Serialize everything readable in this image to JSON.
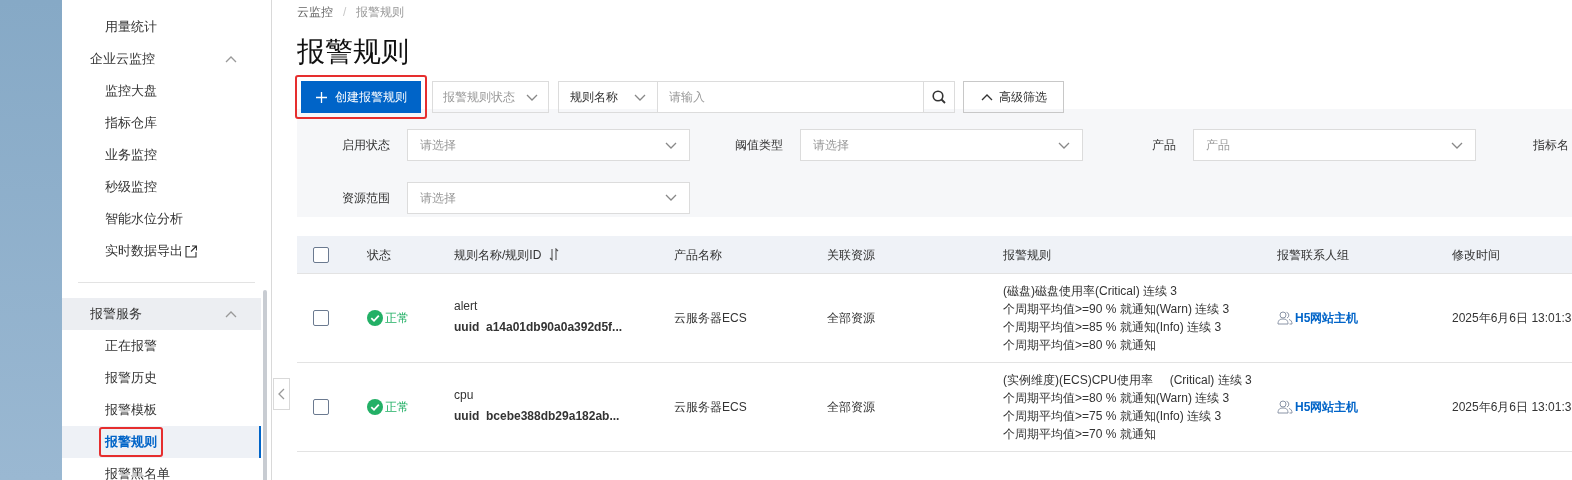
{
  "sidebar": {
    "top_items": [
      {
        "label": "用量统计"
      }
    ],
    "groups": [
      {
        "label": "企业云监控",
        "expanded": true,
        "shaded": false,
        "items": [
          {
            "label": "监控大盘",
            "selected": false,
            "external": false,
            "highlighted": false
          },
          {
            "label": "指标仓库",
            "selected": false,
            "external": false,
            "highlighted": false
          },
          {
            "label": "业务监控",
            "selected": false,
            "external": false,
            "highlighted": false
          },
          {
            "label": "秒级监控",
            "selected": false,
            "external": false,
            "highlighted": false
          },
          {
            "label": "智能水位分析",
            "selected": false,
            "external": false,
            "highlighted": false
          },
          {
            "label": "实时数据导出",
            "selected": false,
            "external": true,
            "highlighted": false
          }
        ]
      },
      {
        "label": "报警服务",
        "expanded": true,
        "shaded": true,
        "items": [
          {
            "label": "正在报警",
            "selected": false,
            "external": false,
            "highlighted": false
          },
          {
            "label": "报警历史",
            "selected": false,
            "external": false,
            "highlighted": false
          },
          {
            "label": "报警模板",
            "selected": false,
            "external": false,
            "highlighted": false
          },
          {
            "label": "报警规则",
            "selected": true,
            "external": false,
            "highlighted": true
          },
          {
            "label": "报警黑名单",
            "selected": false,
            "external": false,
            "highlighted": false
          }
        ]
      }
    ]
  },
  "breadcrumb": {
    "separator": "/",
    "items": [
      "云监控",
      "报警规则"
    ]
  },
  "title": "报警规则",
  "toolbar": {
    "create_button": {
      "label": "创建报警规则",
      "highlighted": true
    },
    "status_select": {
      "placeholder": "报警规则状态"
    },
    "search": {
      "field": "规则名称",
      "placeholder": "请输入"
    },
    "advanced_filter_button": {
      "label": "高级筛选",
      "expanded": true
    }
  },
  "filters": [
    {
      "label": "启用状态",
      "placeholder": "请选择"
    },
    {
      "label": "阈值类型",
      "placeholder": "请选择"
    },
    {
      "label": "产品",
      "placeholder": "产品"
    },
    {
      "label": "指标名"
    },
    {
      "label": "资源范围",
      "placeholder": "请选择"
    }
  ],
  "table": {
    "select_all_checked": false,
    "columns": [
      {
        "label": "状态",
        "sortable": false
      },
      {
        "label": "规则名称/规则ID",
        "sortable": true
      },
      {
        "label": "产品名称",
        "sortable": false
      },
      {
        "label": "关联资源",
        "sortable": false
      },
      {
        "label": "报警规则",
        "sortable": false
      },
      {
        "label": "报警联系人组",
        "sortable": false
      },
      {
        "label": "修改时间",
        "sortable": false
      }
    ],
    "rows": [
      {
        "checked": false,
        "status": "正常",
        "name": "alert",
        "id": "uuid  a14a01db90a0a392d5f...",
        "product": "云服务器ECS",
        "resources": "全部资源",
        "rule_lines": [
          "(磁盘)磁盘使用率(Critical) 连续 3",
          "个周期平均值>=90 % 就通知(Warn) 连续 3",
          "个周期平均值>=85 % 就通知(Info) 连续 3",
          "个周期平均值>=80 % 就通知"
        ],
        "contact_group": "H5网站主机",
        "modified": "2025年6月6日 13:01:3"
      },
      {
        "checked": false,
        "status": "正常",
        "name": "cpu",
        "id": "uuid  bcebe388db29a182ab...",
        "product": "云服务器ECS",
        "resources": "全部资源",
        "rule_lines": [
          "(实例维度)(ECS)CPU使用率     (Critical) 连续 3",
          "个周期平均值>=80 % 就通知(Warn) 连续 3",
          "个周期平均值>=75 % 就通知(Info) 连续 3",
          "个周期平均值>=70 % 就通知"
        ],
        "contact_group": "H5网站主机",
        "modified": "2025年6月6日 13:01:3"
      }
    ]
  }
}
